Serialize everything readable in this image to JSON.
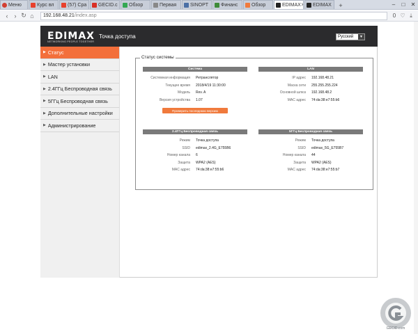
{
  "browser": {
    "tabs": [
      {
        "label": "Меню",
        "color": "#d23f31"
      },
      {
        "label": "Курс вл",
        "color": "#e8412d"
      },
      {
        "label": "(57) Сра",
        "color": "#e8412d"
      },
      {
        "label": "GECID.c",
        "color": "#d93025"
      },
      {
        "label": "Обзор",
        "color": "#34a853"
      },
      {
        "label": "Первая",
        "color": "#888888"
      },
      {
        "label": "SINOPT",
        "color": "#4a6fa5"
      },
      {
        "label": "Финанс",
        "color": "#3f8b3a"
      },
      {
        "label": "Обзор",
        "color": "#f07a3c"
      },
      {
        "label": "EDIMAX",
        "color": "#222222",
        "active": true
      },
      {
        "label": "EDIMAX",
        "color": "#222222"
      }
    ],
    "new_tab": "+",
    "url_host": "192.168.48.21",
    "url_path": "/index.asp",
    "win_min": "–",
    "win_max": "□",
    "win_close": "✕",
    "addr_badge": "0",
    "heart": "♡",
    "download": "⤓"
  },
  "header": {
    "logo": "EDIMAX",
    "logo_tagline": "NETWORKING PEOPLE TOGETHER",
    "title": "Точка доступа",
    "language": "Русский"
  },
  "sidebar": {
    "items": [
      {
        "label": "Статус",
        "active": true
      },
      {
        "label": "Мастер установки"
      },
      {
        "label": "LAN"
      },
      {
        "label": "2.4ГГц Беспроводная связь"
      },
      {
        "label": "5ГГц Беспроводная связь"
      },
      {
        "label": "Дополнительные настройки"
      },
      {
        "label": "Администрирование"
      }
    ]
  },
  "status": {
    "legend": "Статус системы",
    "system": {
      "header": "Система",
      "rows": [
        {
          "label": "Системная информация",
          "value": "Ретранслятор"
        },
        {
          "label": "Текущее время",
          "value": "2018/4/19  11:30:00"
        },
        {
          "label": "Модель",
          "value": "Rev. A"
        },
        {
          "label": "Версия устройства",
          "value": "1.07"
        }
      ],
      "button": "Проверить последнюю версию"
    },
    "lan": {
      "header": "LAN",
      "rows": [
        {
          "label": "IP адрес",
          "value": "192.168.48.21"
        },
        {
          "label": "Маска сети",
          "value": "255.255.255.224"
        },
        {
          "label": "Основной шлюз",
          "value": "192.168.48.2"
        },
        {
          "label": "MAC адрес",
          "value": "74:da:38:e7:55:b6"
        }
      ]
    },
    "wifi24": {
      "header": "2.4ГГц  Беспроводная связь",
      "rows": [
        {
          "label": "Режим",
          "value": "Точка доступа"
        },
        {
          "label": "SSID",
          "value": "edimax_2.4G_E755B6"
        },
        {
          "label": "Номер канала",
          "value": "6"
        },
        {
          "label": "Защита",
          "value": "WPA2 (AES)"
        },
        {
          "label": "MAC адрес",
          "value": "74:da:38:e7:55:b6"
        }
      ]
    },
    "wifi5": {
      "header": "5ГГц  Беспроводная связь",
      "rows": [
        {
          "label": "Режим",
          "value": "Точка доступа"
        },
        {
          "label": "SSID",
          "value": "edimax_5G_E755B7"
        },
        {
          "label": "Номер канала",
          "value": "44"
        },
        {
          "label": "Защита",
          "value": "WPA2 (AES)"
        },
        {
          "label": "MAC адрес",
          "value": "74:da:38:e7:55:b7"
        }
      ]
    }
  },
  "watermark": {
    "text": "GECID.com"
  },
  "colors": {
    "accent": "#f36f3b",
    "header_bg": "#2b2b2d",
    "panel_head": "#7a7a7a"
  }
}
